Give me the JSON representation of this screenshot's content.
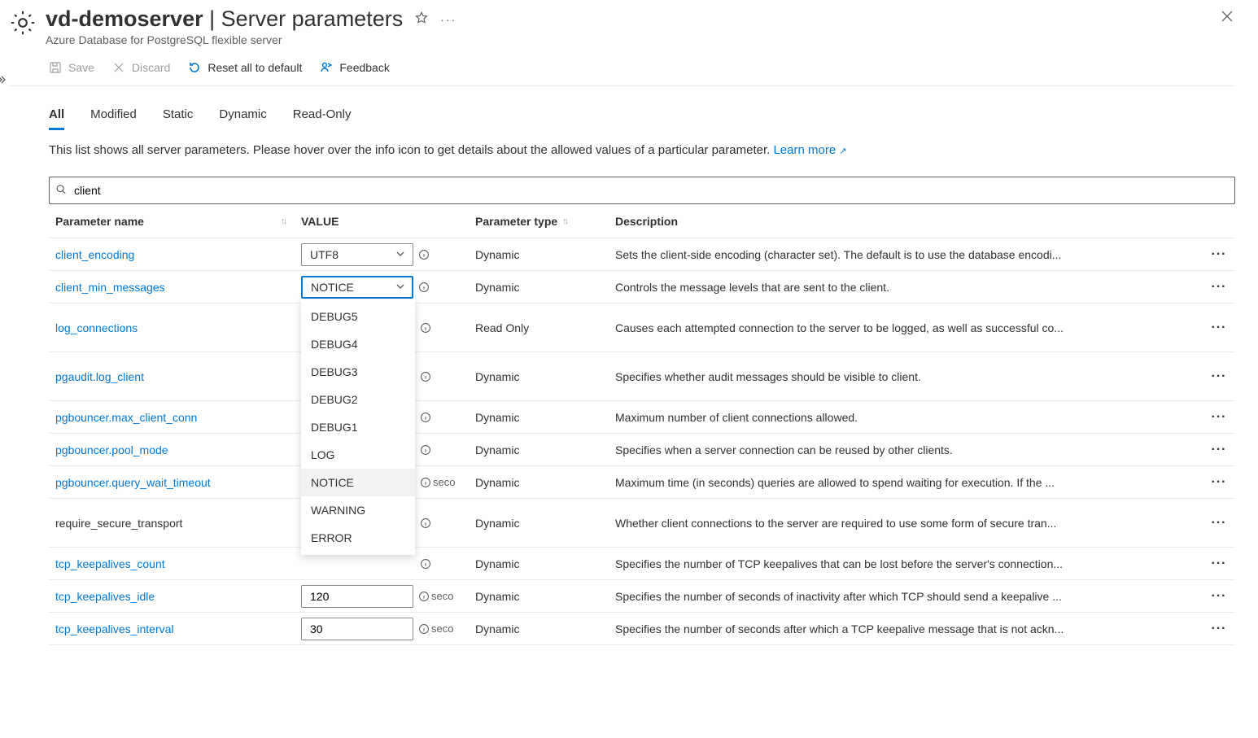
{
  "header": {
    "resource_name": "vd-demoserver",
    "page_name": "Server parameters",
    "subtitle": "Azure Database for PostgreSQL flexible server"
  },
  "toolbar": {
    "save": "Save",
    "discard": "Discard",
    "reset": "Reset all to default",
    "feedback": "Feedback"
  },
  "tabs": {
    "items": [
      "All",
      "Modified",
      "Static",
      "Dynamic",
      "Read-Only"
    ],
    "active_index": 0,
    "description": "This list shows all server parameters. Please hover over the info icon to get details about the allowed values of a particular parameter.",
    "learn_more": "Learn more"
  },
  "search": {
    "value": "client"
  },
  "columns": {
    "name": "Parameter name",
    "value": "VALUE",
    "type": "Parameter type",
    "desc": "Description"
  },
  "dropdown_options": [
    "DEBUG5",
    "DEBUG4",
    "DEBUG3",
    "DEBUG2",
    "DEBUG1",
    "LOG",
    "NOTICE",
    "WARNING",
    "ERROR"
  ],
  "dropdown_selected": "NOTICE",
  "rows": [
    {
      "name": "client_encoding",
      "link": true,
      "value": "UTF8",
      "value_kind": "select",
      "info_suffix": "",
      "type": "Dynamic",
      "desc": "Sets the client-side encoding (character set). The default is to use the database encodi...",
      "tall": false,
      "open": false
    },
    {
      "name": "client_min_messages",
      "link": true,
      "value": "NOTICE",
      "value_kind": "select",
      "info_suffix": "",
      "type": "Dynamic",
      "desc": "Controls the message levels that are sent to the client.",
      "tall": false,
      "open": true
    },
    {
      "name": "log_connections",
      "link": true,
      "value": "",
      "value_kind": "hidden",
      "info_suffix": "",
      "type": "Read Only",
      "desc": "Causes each attempted connection to the server to be logged, as well as successful co...",
      "tall": true,
      "open": false
    },
    {
      "name": "pgaudit.log_client",
      "link": true,
      "value": "",
      "value_kind": "hidden",
      "info_suffix": "",
      "type": "Dynamic",
      "desc": "Specifies whether audit messages should be visible to client.",
      "tall": true,
      "open": false
    },
    {
      "name": "pgbouncer.max_client_conn",
      "link": true,
      "value": "",
      "value_kind": "hidden",
      "info_suffix": "",
      "type": "Dynamic",
      "desc": "Maximum number of client connections allowed.",
      "tall": false,
      "open": false
    },
    {
      "name": "pgbouncer.pool_mode",
      "link": true,
      "value": "",
      "value_kind": "hidden",
      "info_suffix": "",
      "type": "Dynamic",
      "desc": "Specifies when a server connection can be reused by other clients.",
      "tall": false,
      "open": false
    },
    {
      "name": "pgbouncer.query_wait_timeout",
      "link": true,
      "value": "",
      "value_kind": "hidden",
      "info_suffix": "seco",
      "type": "Dynamic",
      "desc": "Maximum time (in seconds) queries are allowed to spend waiting for execution. If the ...",
      "tall": false,
      "open": false
    },
    {
      "name": "require_secure_transport",
      "link": false,
      "value": "",
      "value_kind": "hidden",
      "info_suffix": "",
      "type": "Dynamic",
      "desc": "Whether client connections to the server are required to use some form of secure tran...",
      "tall": true,
      "open": false
    },
    {
      "name": "tcp_keepalives_count",
      "link": true,
      "value": "",
      "value_kind": "hidden",
      "info_suffix": "",
      "type": "Dynamic",
      "desc": "Specifies the number of TCP keepalives that can be lost before the server's connection...",
      "tall": false,
      "open": false
    },
    {
      "name": "tcp_keepalives_idle",
      "link": true,
      "value": "120",
      "value_kind": "input-cut",
      "info_suffix": "seco",
      "type": "Dynamic",
      "desc": "Specifies the number of seconds of inactivity after which TCP should send a keepalive ...",
      "tall": false,
      "open": false
    },
    {
      "name": "tcp_keepalives_interval",
      "link": true,
      "value": "30",
      "value_kind": "input",
      "info_suffix": "seco",
      "type": "Dynamic",
      "desc": "Specifies the number of seconds after which a TCP keepalive message that is not ackn...",
      "tall": false,
      "open": false
    }
  ]
}
